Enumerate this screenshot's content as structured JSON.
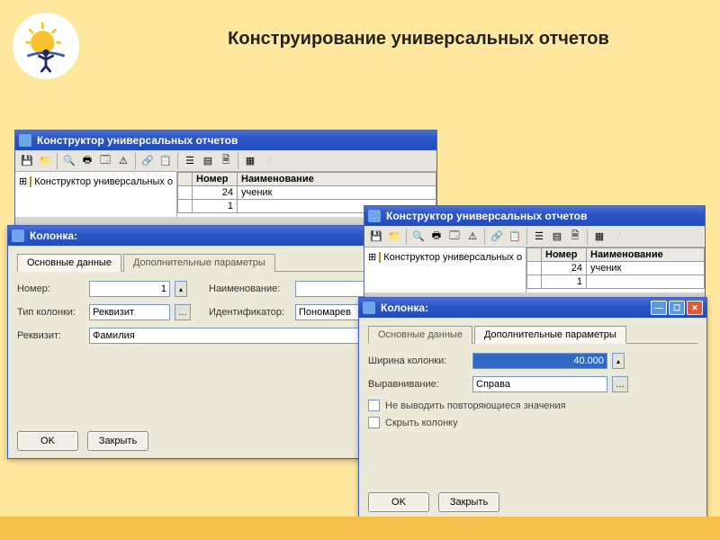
{
  "slide_title": "Конструирование универсальных отчетов",
  "app": {
    "title": "Конструктор универсальных отчетов",
    "tree_root": "Конструктор универсальных о",
    "grid": {
      "col_number": "Номер",
      "col_name": "Наименование",
      "rows": [
        {
          "num": "24",
          "name": "ученик"
        },
        {
          "num": "1",
          "name": ""
        }
      ]
    }
  },
  "dialog1": {
    "title": "Колонка:",
    "tab_main": "Основные данные",
    "tab_extra": "Дополнительные параметры",
    "lbl_number": "Номер:",
    "val_number": "1",
    "lbl_name": "Наименование:",
    "val_name": "",
    "lbl_coltype": "Тип колонки:",
    "val_coltype": "Реквизит",
    "lbl_ident": "Идентификатор:",
    "val_ident": "Пономарев",
    "lbl_rekv": "Реквизит:",
    "val_rekv": "Фамилия",
    "btn_ok": "OK",
    "btn_close": "Закрыть"
  },
  "dialog2": {
    "title": "Колонка:",
    "tab_main": "Основные данные",
    "tab_extra": "Дополнительные параметры",
    "lbl_width": "Ширина колонки:",
    "val_width": "40.000",
    "lbl_align": "Выравнивание:",
    "val_align": "Справа",
    "chk_norepeat": "Не выводить повторяющиеся значения",
    "chk_hide": "Скрыть колонку",
    "btn_ok": "OK",
    "btn_close": "Закрыть"
  }
}
